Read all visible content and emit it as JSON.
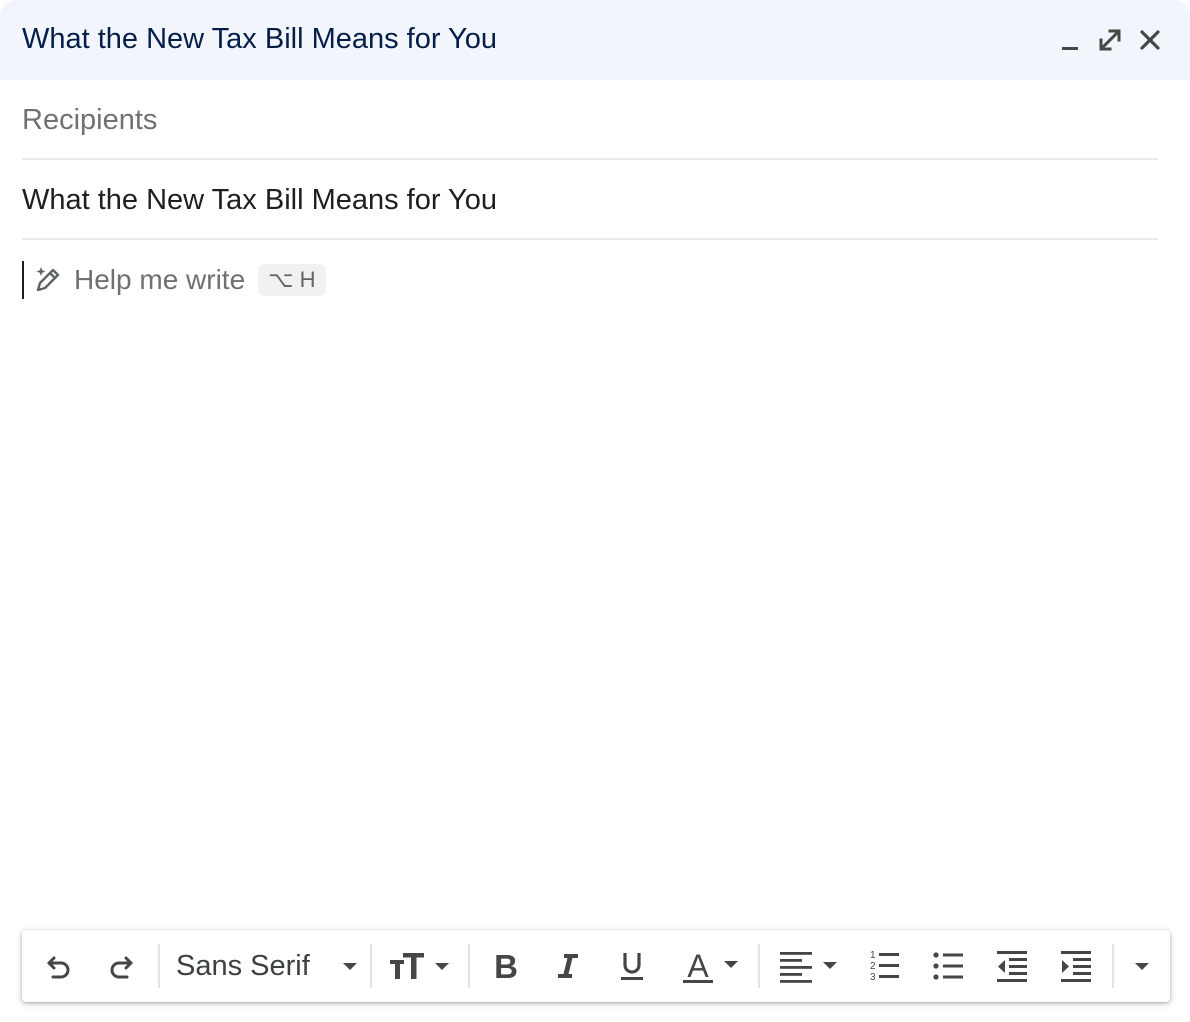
{
  "window": {
    "title": "What the New Tax Bill Means for You",
    "controls": [
      "minimize-icon",
      "expand-icon",
      "close-icon"
    ]
  },
  "compose": {
    "recipients_placeholder": "Recipients",
    "subject": "What the New Tax Bill Means for You",
    "body": ""
  },
  "help_me_write": {
    "label": "Help me write",
    "shortcut": "⌥ H",
    "icon": "pen-sparkle-icon"
  },
  "toolbar": {
    "font_name": "Sans Serif",
    "buttons": [
      "undo-icon",
      "redo-icon",
      "font-dropdown-icon",
      "text-size-icon",
      "bold-icon",
      "italic-icon",
      "underline-icon",
      "text-color-icon",
      "align-icon",
      "numbered-list-icon",
      "bulleted-list-icon",
      "indent-less-icon",
      "indent-more-icon",
      "more-formatting-icon"
    ]
  },
  "colors": {
    "titlebar_bg": "#f2f6fc",
    "title_text": "#041e49",
    "icon": "#444746",
    "placeholder": "#717171",
    "divider": "#e8eaed"
  }
}
